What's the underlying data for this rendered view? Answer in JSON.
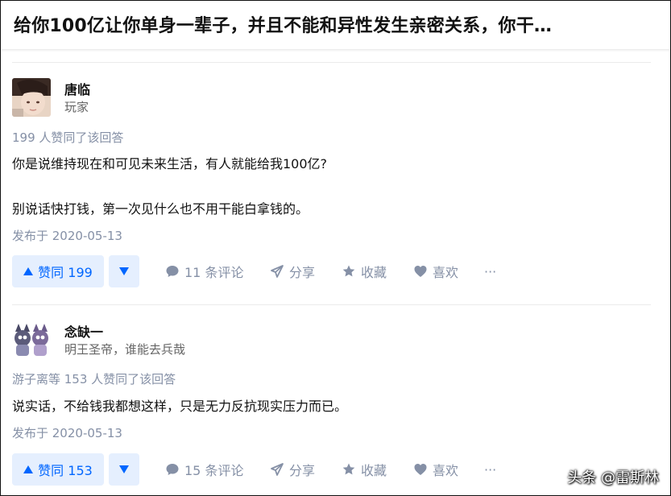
{
  "question": {
    "title": "给你100亿让你单身一辈子，并且不能和异性发生亲密关系，你干…"
  },
  "answers": [
    {
      "author": {
        "name": "唐临",
        "bio": "玩家"
      },
      "vote_summary": "199 人赞同了该回答",
      "content": [
        "你是说维持现在和可见未来生活，有人就能给我100亿?",
        "别说话快打钱，第一次见什么也不用干能白拿钱的。"
      ],
      "published": "发布于 2020-05-13",
      "actions": {
        "vote_up": "赞同 199",
        "comments": "11 条评论",
        "share": "分享",
        "collect": "收藏",
        "like": "喜欢",
        "more": "···"
      }
    },
    {
      "author": {
        "name": "念缺一",
        "bio": "明王圣帝，谁能去兵哉"
      },
      "vote_summary": "游子离等 153 人赞同了该回答",
      "content": [
        "说实话，不给钱我都想这样，只是无力反抗现实压力而已。"
      ],
      "published": "发布于 2020-05-13",
      "actions": {
        "vote_up": "赞同 153",
        "comments": "15 条评论",
        "share": "分享",
        "collect": "收藏",
        "like": "喜欢",
        "more": "···"
      }
    }
  ],
  "watermark": "头条 @雷斯林",
  "colors": {
    "accent": "#0066ff",
    "accent_bg": "#e5effe",
    "meta_text": "#8590a6"
  }
}
